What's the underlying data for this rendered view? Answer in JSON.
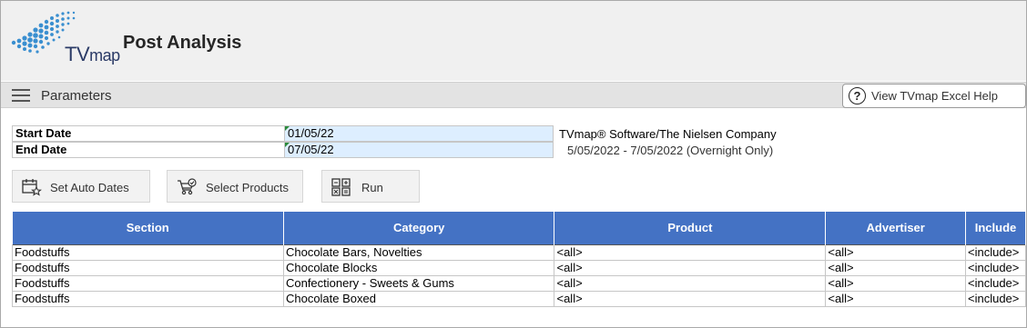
{
  "app": {
    "logo_text_tv": "TV",
    "logo_text_map": "map",
    "title": "Post Analysis"
  },
  "parameters_bar": {
    "label": "Parameters",
    "help_button_label": "View TVmap Excel Help",
    "help_icon_glyph": "?"
  },
  "dates": {
    "start_label": "Start Date",
    "start_value": "01/05/22",
    "end_label": "End Date",
    "end_value": "07/05/22"
  },
  "info": {
    "company": "TVmap® Software/The Nielsen Company",
    "date_range": "5/05/2022 - 7/05/2022 (Overnight Only)"
  },
  "actions": {
    "set_auto_dates": "Set Auto Dates",
    "select_products": "Select Products",
    "run": "Run"
  },
  "table": {
    "headers": [
      "Section",
      "Category",
      "Product",
      "Advertiser",
      "Include"
    ],
    "rows": [
      [
        "Foodstuffs",
        "Chocolate Bars, Novelties",
        "<all>",
        "<all>",
        "<include>"
      ],
      [
        "Foodstuffs",
        "Chocolate Blocks",
        "<all>",
        "<all>",
        "<include>"
      ],
      [
        "Foodstuffs",
        "Confectionery - Sweets & Gums",
        "<all>",
        "<all>",
        "<include>"
      ],
      [
        "Foodstuffs",
        "Chocolate Boxed",
        "<all>",
        "<all>",
        "<include>"
      ]
    ]
  },
  "colors": {
    "table_header_bg": "#4472c4",
    "date_cell_bg": "#ddeeff",
    "logo_blue": "#3a8fd0"
  }
}
